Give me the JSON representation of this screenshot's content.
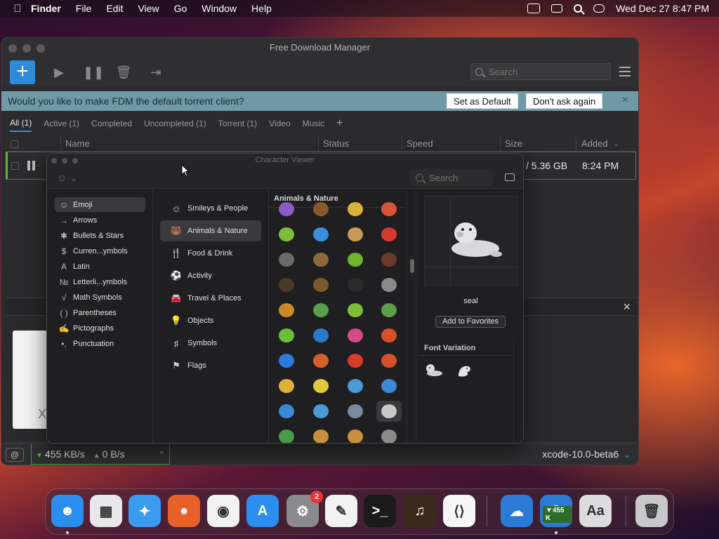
{
  "menubar": {
    "apple_icon": "apple-logo-icon",
    "app_name": "Finder",
    "menus": [
      "File",
      "Edit",
      "View",
      "Go",
      "Window",
      "Help"
    ],
    "clock": "Wed Dec 27  8:47 PM"
  },
  "fdm": {
    "title": "Free Download Manager",
    "add_label": "+",
    "search_placeholder": "Search",
    "banner": {
      "text": "Would you like to make FDM the default torrent client?",
      "set_default": "Set as Default",
      "dont_ask": "Don't ask again",
      "close": "×"
    },
    "tabs": [
      {
        "label": "All (1)",
        "active": true
      },
      {
        "label": "Active (1)"
      },
      {
        "label": "Completed"
      },
      {
        "label": "Uncompleted (1)"
      },
      {
        "label": "Torrent (1)"
      },
      {
        "label": "Video"
      },
      {
        "label": "Music"
      }
    ],
    "add_tab": "+",
    "columns": {
      "name": "Name",
      "status": "Status",
      "speed": "Speed",
      "size": "Size",
      "added": "Added"
    },
    "row": {
      "size": "/ 5.36 GB",
      "added": "8:24 PM"
    },
    "detail_close": "×",
    "status": {
      "download_speed": "455 KB/s",
      "upload_speed": "0 B/s",
      "current_file": "xcode-10.0-beta6"
    }
  },
  "charviewer": {
    "title": "Character Viewer",
    "search_placeholder": "Search",
    "sidebar": [
      {
        "label": "Emoji",
        "icon": "☺",
        "selected": true
      },
      {
        "label": "Arrows",
        "icon": "→"
      },
      {
        "label": "Bullets & Stars",
        "icon": "✱"
      },
      {
        "label": "Curren...ymbols",
        "icon": "$"
      },
      {
        "label": "Latin",
        "icon": "A"
      },
      {
        "label": "Letterli...ymbols",
        "icon": "№"
      },
      {
        "label": "Math Symbols",
        "icon": "√"
      },
      {
        "label": "Parentheses",
        "icon": "( )"
      },
      {
        "label": "Pictographs",
        "icon": "✍"
      },
      {
        "label": "Punctuation",
        "icon": "•,"
      }
    ],
    "categories": [
      {
        "label": "Smileys & People",
        "icon": "☺"
      },
      {
        "label": "Animals & Nature",
        "icon": "🐻",
        "selected": true
      },
      {
        "label": "Food & Drink",
        "icon": "🍴"
      },
      {
        "label": "Activity",
        "icon": "⚽"
      },
      {
        "label": "Travel & Places",
        "icon": "🚘"
      },
      {
        "label": "Objects",
        "icon": "💡"
      },
      {
        "label": "Symbols",
        "icon": "♯"
      },
      {
        "label": "Flags",
        "icon": "⚑"
      }
    ],
    "section_header": "Animals & Nature",
    "emoji_colors": [
      [
        "#8a5cc4",
        "#8b5a2b",
        "#d9b23a",
        "#d9533a"
      ],
      [
        "#7bbd3a",
        "#3a8fe0",
        "#c79a58",
        "#d63a2f"
      ],
      [
        "#6a6a6a",
        "#8b6b3a",
        "#6cb52c",
        "#6a3a2a"
      ],
      [
        "#4a3a2a",
        "#7a5a2a",
        "#2a2a2a",
        "#8a8a8a"
      ],
      [
        "#c98a2a",
        "#5aa04a",
        "#7dbd3a",
        "#5aa04a"
      ],
      [
        "#6abd3a",
        "#2a7ac8",
        "#d64a8a",
        "#d6502a"
      ],
      [
        "#2a7ae0",
        "#d6602a",
        "#d63a2a",
        "#d6502a"
      ],
      [
        "#e0b03a",
        "#e0c83a",
        "#4a9ad6",
        "#3a8ad6"
      ],
      [
        "#3a8ad6",
        "#4a9ad6",
        "#7a8a9a",
        "#c8c8c8"
      ],
      [
        "#4a9a4a",
        "#c8903a",
        "#c8903a",
        "#8a8a8a"
      ]
    ],
    "selected_emoji_name": "seal",
    "add_to_favorites": "Add to Favorites",
    "font_variation_title": "Font Variation"
  },
  "dock": {
    "apps": [
      {
        "name": "finder-icon",
        "color": "#2a8ef0",
        "glyph": "☻"
      },
      {
        "name": "launchpad-icon",
        "color": "#e8e8ea",
        "glyph": "▦"
      },
      {
        "name": "safari-icon",
        "color": "#3a9af0",
        "glyph": "✦"
      },
      {
        "name": "firefox-icon",
        "color": "#e8602a",
        "glyph": "●"
      },
      {
        "name": "chrome-icon",
        "color": "#f2f2f2",
        "glyph": "◉"
      },
      {
        "name": "app-store-icon",
        "color": "#2a8ef0",
        "glyph": "A"
      },
      {
        "name": "system-settings-icon",
        "color": "#8a8a8c",
        "glyph": "⚙",
        "badge": "2"
      },
      {
        "name": "textedit-icon",
        "color": "#f2f2f2",
        "glyph": "✎"
      },
      {
        "name": "terminal-icon",
        "color": "#1a1a1a",
        "glyph": ">_"
      },
      {
        "name": "garageband-icon",
        "color": "#3a2a1a",
        "glyph": "♫"
      },
      {
        "name": "vscode-icon",
        "color": "#f6f6f6",
        "glyph": "⟨⟩"
      },
      {
        "name": "weather-icon",
        "color": "#2a7ad6",
        "glyph": "☁"
      },
      {
        "name": "fdm-icon",
        "color": "#2a7ad6",
        "glyph": "⇩",
        "badge_text": "▼455 K"
      },
      {
        "name": "font-book-icon",
        "color": "#dcdcde",
        "glyph": "Aa"
      },
      {
        "name": "trash-icon",
        "color": "#c8c8ca",
        "glyph": "🗑"
      }
    ]
  }
}
